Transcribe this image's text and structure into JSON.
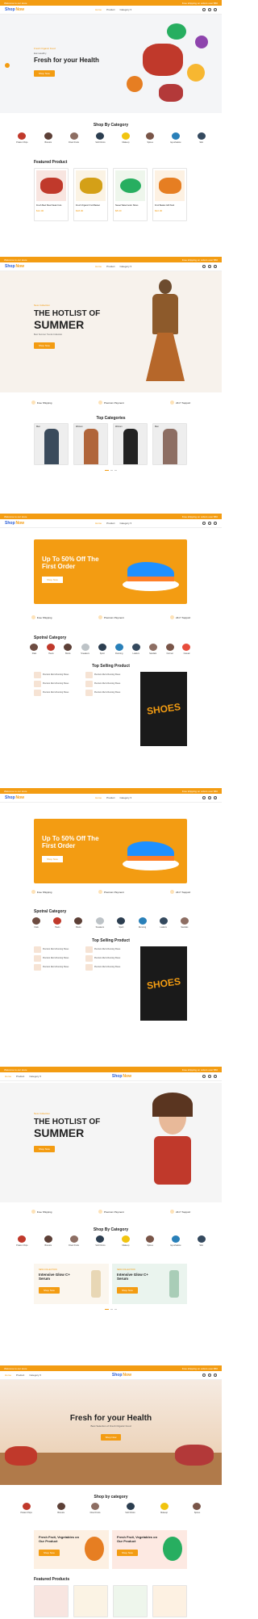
{
  "brand": {
    "name_a": "Shop",
    "name_b": "Now"
  },
  "topbar": {
    "left": "Welcome to our store",
    "right": "Free shipping on orders over $50"
  },
  "nav": {
    "home": "Home",
    "product": "Product",
    "category": "Category ▾"
  },
  "s1": {
    "hero_small": "Fresh Organic Food",
    "hero_kicker": "Eat Healthy",
    "hero_title": "Fresh for your Health",
    "hero_btn": "Shop Now",
    "cat_title": "Shop By Category",
    "categories": [
      "Potato Chips",
      "Biscuits",
      "Dried Fruits",
      "Soft Drinks",
      "Makeup",
      "Spices",
      "Eyeshadow",
      "Skin"
    ],
    "feat_title": "Featured Product",
    "products": [
      {
        "name": "Fresh Beef Meat Steak Cuts",
        "price": "$12.00"
      },
      {
        "name": "Fresh Organic Fruit Basket",
        "price": "$18.00"
      },
      {
        "name": "Sweet Watermelon Slices",
        "price": "$8.00"
      },
      {
        "name": "Fruit Basket Gift Pack",
        "price": "$22.00"
      }
    ]
  },
  "s2": {
    "hero_small": "New Collection",
    "hero_l1": "THE HOTLIST OF",
    "hero_l2": "SUMMER",
    "hero_desc": "Best Summer Trends Collection",
    "hero_btn": "Shop Now",
    "features": [
      "Free Shipping",
      "Premium Payment",
      "24×7 Support"
    ],
    "cat_title": "Top Categories",
    "people": [
      "Men",
      "Women",
      "Women",
      "Men"
    ]
  },
  "s3": {
    "hero_l1": "Up To 50% Off The",
    "hero_l2": "First Order",
    "hero_btn": "Shop Now",
    "features": [
      "Free Shipping",
      "Premium Payment",
      "24×7 Support"
    ],
    "cat_title": "Spotral Category",
    "shoes": [
      "Flats",
      "Heels",
      "Boots",
      "Sneakers",
      "Sport",
      "Running",
      "Loafers",
      "Sandals",
      "Formal",
      "Casual"
    ],
    "sell_title": "Top Selling Product",
    "sell_items": [
      "Premium Men's Running Shoes",
      "Premium Men's Running Shoes",
      "Premium Men's Running Shoes",
      "Premium Men's Running Shoes",
      "Premium Men's Running Shoes",
      "Premium Men's Running Shoes"
    ],
    "poster": "SHOES"
  },
  "s4": {
    "hero_l1": "Up To 50% Off The",
    "hero_l2": "First Order",
    "hero_btn": "Shop Now",
    "features": [
      "Free Shipping",
      "Premium Payment",
      "24×7 Support"
    ],
    "cat_title": "Spotral Category",
    "sell_title": "Top Selling Product",
    "poster": "SHOES"
  },
  "s5": {
    "hero_small": "New Collection",
    "hero_l1": "THE HOTLIST OF",
    "hero_l2": "SUMMER",
    "hero_btn": "Shop Now",
    "features": [
      "Free Shipping",
      "Premium Payment",
      "24×7 Support"
    ],
    "cat_title": "Shop By Category",
    "promo1_tag": "NEW COLLECTION",
    "promo1_title": "Intensive Glow C+ Serum",
    "promo2_tag": "NEW COLLECTION",
    "promo2_title": "Intensive Glow C+ Serum",
    "promo_btn": "Shop Now"
  },
  "s6": {
    "hero_title": "Fresh for your Health",
    "hero_desc": "Best Selection of Fresh Organic Food",
    "hero_btn": "Shop Now",
    "cat_title": "Shop by category",
    "promo1_title": "Fresh Fruit, Vegetables on Our Product",
    "promo2_title": "Fresh Fruit, Vegetables on Our Product",
    "promo_btn": "Shop Now",
    "feat_title": "Featured Products"
  },
  "colors": {
    "accent": "#f39c12",
    "brand": "#2c5fd8"
  }
}
